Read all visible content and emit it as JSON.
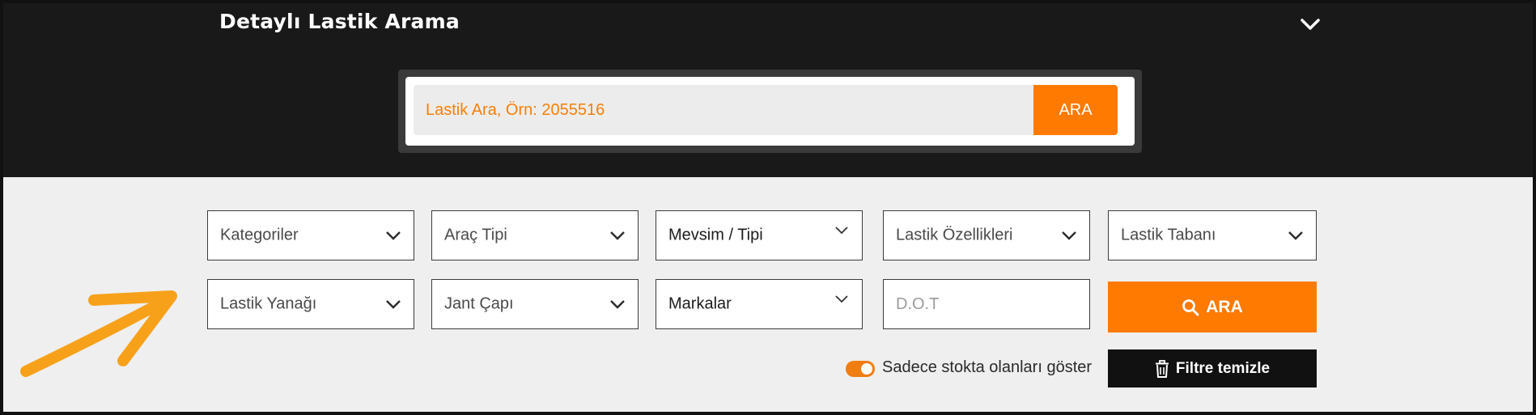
{
  "header": {
    "title": "Detaylı Lastik Arama",
    "collapse_icon": "chevron-down-icon"
  },
  "search": {
    "placeholder": "Lastik Ara, Örn: 2055516",
    "button_label": "ARA"
  },
  "filters": {
    "row1": [
      {
        "label": "Kategoriler"
      },
      {
        "label": "Araç Tipi"
      },
      {
        "label": "Mevsim / Tipi"
      },
      {
        "label": "Lastik Özellikleri"
      },
      {
        "label": "Lastik Tabanı"
      }
    ],
    "row2": [
      {
        "label": "Lastik Yanağı"
      },
      {
        "label": "Jant Çapı"
      },
      {
        "label": "Markalar"
      }
    ],
    "dot_placeholder": "D.O.T",
    "search_button_label": "ARA",
    "search_button_icon": "search-icon"
  },
  "stock_toggle": {
    "label": "Sadece stokta olanları göster",
    "checked": true
  },
  "clear_button": {
    "label": "Filtre temizle",
    "icon": "trash-icon"
  },
  "annotation": {
    "icon": "arrow-icon",
    "color": "#f7a11a"
  },
  "colors": {
    "accent": "#ff7a00",
    "header_bg": "#191919",
    "panel_bg": "#efefef"
  }
}
